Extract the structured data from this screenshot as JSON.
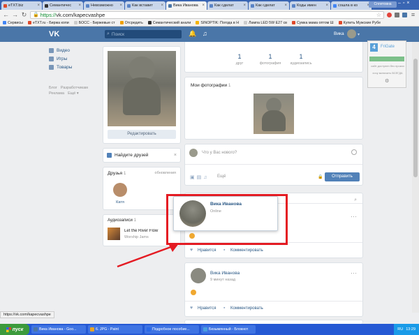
{
  "browser": {
    "tabs": [
      {
        "title": "eTXT.biz",
        "icon_color": "#e04a2a"
      },
      {
        "title": "Семантичес",
        "icon_color": "#333333"
      },
      {
        "title": "Невозможно",
        "icon_color": "#5a84c6"
      },
      {
        "title": "Как вставит",
        "icon_color": "#5a84c6"
      },
      {
        "title": "Вика Иванова",
        "icon_color": "#4a76a8"
      },
      {
        "title": "Как сделат",
        "icon_color": "#5a84c6"
      },
      {
        "title": "Как сделат",
        "icon_color": "#5a84c6"
      },
      {
        "title": "Коды имен",
        "icon_color": "#5a84c6"
      },
      {
        "title": "сошла в ко",
        "icon_color": "#4285f4"
      }
    ],
    "active_tab_index": 4,
    "profile_label": "Сплетовна",
    "address": {
      "scheme": "https://",
      "host": "vk.com",
      "path": "/kapecvashpe"
    },
    "bookmarks": [
      {
        "label": "Сервисы",
        "icon_color": "#4285f4"
      },
      {
        "label": "eTXT.ru - Биржа копи",
        "icon_color": "#e04a2a"
      },
      {
        "label": "БОСС - Биржевые ст",
        "icon_color": "#cccccc"
      },
      {
        "label": "Отсредить",
        "icon_color": "#f0a000"
      },
      {
        "label": "Семантический анали",
        "icon_color": "#333333"
      },
      {
        "label": "SINOPTIK: Погода в Н",
        "icon_color": "#f5b400"
      },
      {
        "label": "Лампа LED 5W E27 св",
        "icon_color": "#cccccc"
      },
      {
        "label": "Сумка мама оптом Ш",
        "icon_color": "#e04a2a"
      },
      {
        "label": "Купить Мужские Рубе",
        "icon_color": "#e04a2a"
      }
    ]
  },
  "vk": {
    "search_placeholder": "Поиск",
    "user_name": "Вика",
    "left_menu": [
      {
        "label": "Видео",
        "icon": "video-icon"
      },
      {
        "label": "Игры",
        "icon": "games-icon"
      },
      {
        "label": "Товары",
        "icon": "goods-icon"
      }
    ],
    "footer_links": [
      "Блог",
      "Разработчикам",
      "Реклама",
      "Ещё ▾"
    ],
    "profile": {
      "edit_button": "Редактировать",
      "find_friends": "Найдите друзей",
      "friends_title": "Друзья",
      "friends_count": "1",
      "friends_updates": "обновления",
      "friend_name": "Катя",
      "audio_title": "Аудиозаписи",
      "audio_count": "1",
      "track_title": "Let the River Flow",
      "track_artist": "Worship Jams"
    },
    "counters": [
      {
        "value": "1",
        "label": "друг"
      },
      {
        "value": "1",
        "label": "фотография"
      },
      {
        "value": "1",
        "label": "аудиозапись"
      }
    ],
    "photos_title": "Мои фотографии",
    "photos_count": "1",
    "composer": {
      "placeholder": "Что у Вас нового?",
      "more": "Ещё",
      "send": "Отправить"
    },
    "hover_card": {
      "name": "Вика Иванова",
      "status": "Online"
    },
    "post1": {
      "like": "Нравится",
      "comment": "Комментировать"
    },
    "post2": {
      "author": "Вика Иванова",
      "time": "9 минут назад",
      "like": "Нравится",
      "comment": "Комментировать"
    },
    "status_url": "https://vk.com/kapecvashpe"
  },
  "extension": {
    "name": "FriGate",
    "line1": "сайт доступен без прокси",
    "line2": "хочу включить ВСЕГДА"
  },
  "taskbar": {
    "start": "пуск",
    "tasks": [
      "Вика Иванова - Goo...",
      "6. JPG - Paint",
      "Подробное пособие...",
      "Безымянный - Блокнот"
    ],
    "lang": "RU",
    "clock": "13:29"
  },
  "colors": {
    "vk_blue": "#4a76a8",
    "highlight_red": "#e41b23",
    "xp_blue": "#2559d4"
  }
}
